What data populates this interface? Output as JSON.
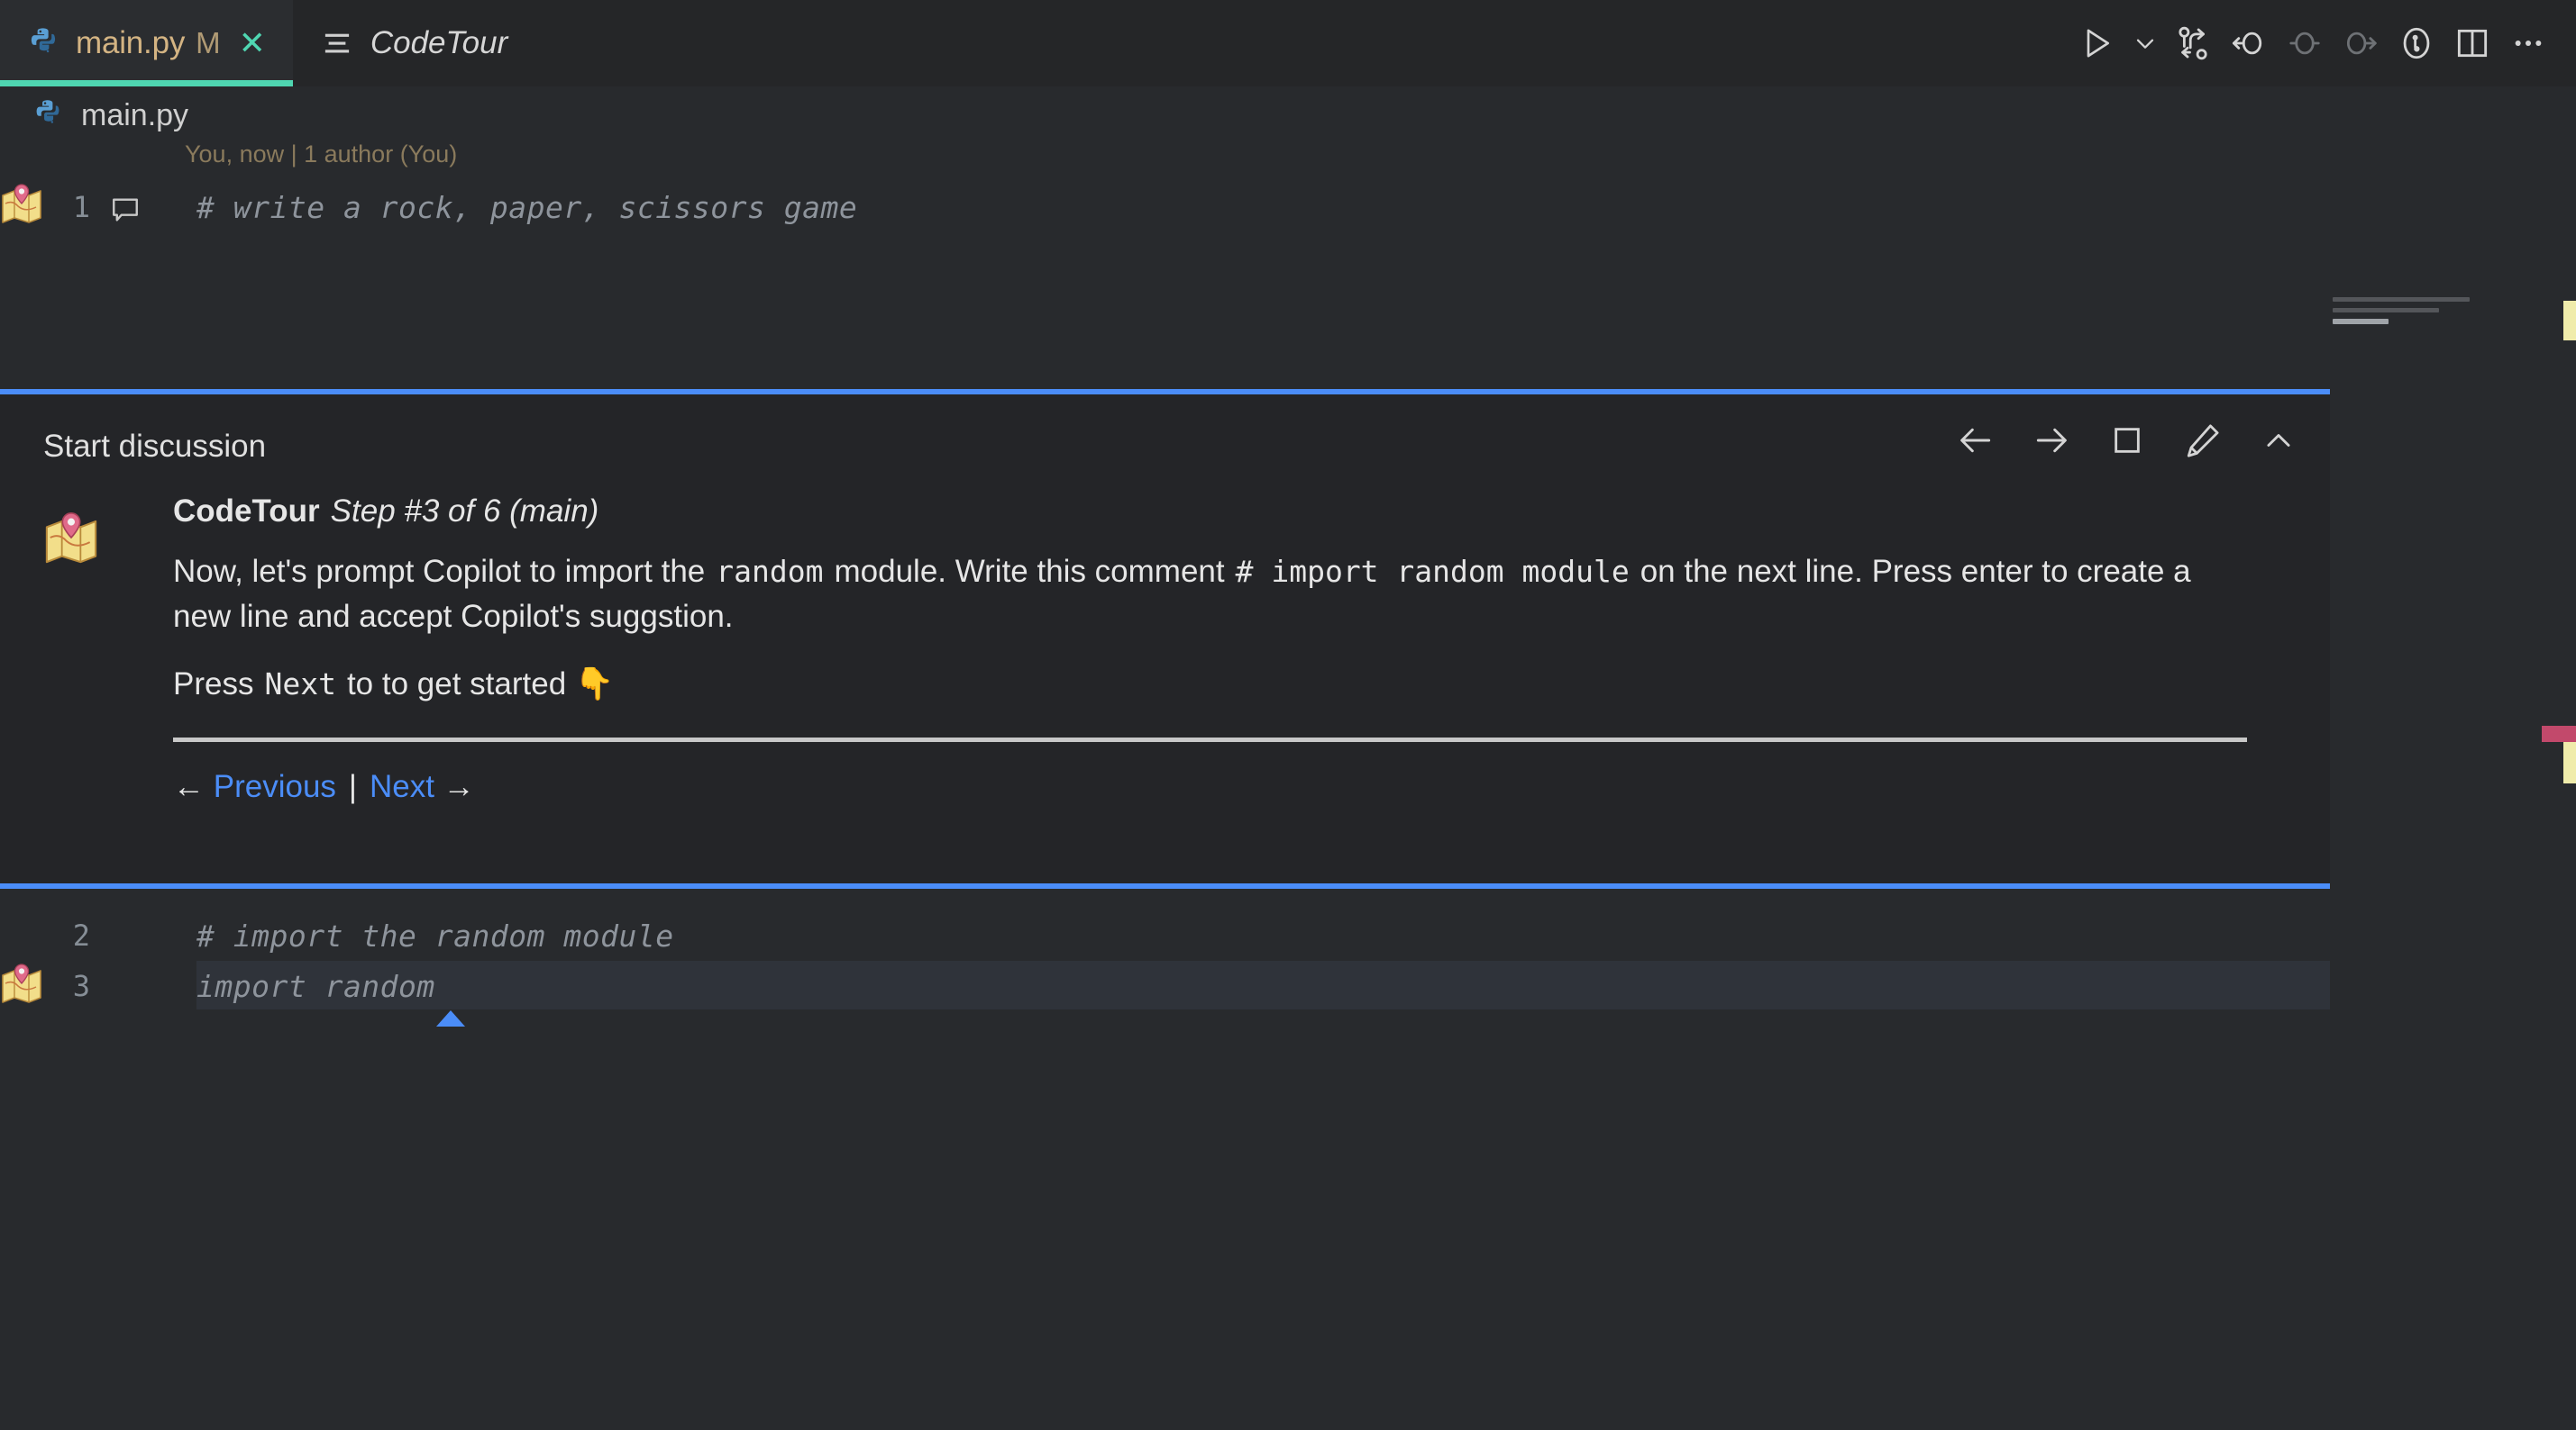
{
  "window": {
    "background": "#282a2d",
    "accent_blue": "#4b8df8",
    "accent_teal": "#4fd6b1"
  },
  "tabs": [
    {
      "label": "main.py",
      "dirty_badge": "M",
      "close_label": "✕",
      "icon": "python-icon",
      "active": true
    },
    {
      "label": "CodeTour",
      "icon": "lines-icon",
      "active": false
    }
  ],
  "toolbar": {
    "buttons": [
      {
        "name": "run-python-file-button",
        "icon": "play-icon",
        "label": "Run Python File"
      },
      {
        "name": "run-options-dropdown",
        "icon": "chevron-down-icon",
        "label": "Run or Debug..."
      },
      {
        "name": "source-control-compare-button",
        "icon": "compare-changes-icon",
        "label": "Open Changes"
      },
      {
        "name": "go-back-button",
        "icon": "arrow-circle-left-icon",
        "label": "Go Back"
      },
      {
        "name": "go-stay-button",
        "icon": "circle-dash-icon",
        "label": "Go Forward"
      },
      {
        "name": "go-forward-button",
        "icon": "arrow-circle-right-icon",
        "label": "Go Forward"
      },
      {
        "name": "run-coverage-button",
        "icon": "beaker-clock-icon",
        "label": "Run Tests with Coverage"
      },
      {
        "name": "split-editor-button",
        "icon": "split-editor-icon",
        "label": "Split Editor Right"
      },
      {
        "name": "more-actions-button",
        "icon": "ellipsis-icon",
        "label": "More Actions..."
      }
    ]
  },
  "breadcrumb": {
    "icon": "python-icon",
    "path": "main.py"
  },
  "editor": {
    "blame": "You, now | 1 author (You)",
    "lines": [
      {
        "number": "1",
        "text": "# write a rock, paper, scissors game",
        "has_comment_icon": true,
        "has_tour_pin": true,
        "current": false
      },
      {
        "number": "2",
        "text": "# import the random module",
        "has_comment_icon": false,
        "has_tour_pin": false,
        "current": false
      },
      {
        "number": "3",
        "text": "import random",
        "has_comment_icon": false,
        "has_tour_pin": true,
        "current": true
      }
    ]
  },
  "codetour_panel": {
    "header": "Start discussion",
    "actions": [
      {
        "name": "previous-step-button",
        "icon": "arrow-left-icon",
        "label": "Previous"
      },
      {
        "name": "next-step-button",
        "icon": "arrow-right-icon",
        "label": "Next"
      },
      {
        "name": "end-tour-button",
        "icon": "stop-square-icon",
        "label": "End Tour"
      },
      {
        "name": "edit-step-button",
        "icon": "pencil-icon",
        "label": "Edit Step"
      },
      {
        "name": "collapse-button",
        "icon": "chevron-up-icon",
        "label": "Collapse"
      }
    ],
    "avatar_icon": "codetour-map-pin-icon",
    "author": "CodeTour",
    "step_meta": "Step #3 of 6 (main)",
    "paragraph1": {
      "part1": "Now, let's prompt Copilot to import the",
      "code1": "random",
      "part2": "module. Write this comment",
      "code2": "# import random module",
      "part3": "on the next line."
    },
    "paragraph1_line2": "Press enter to create a new line and accept Copilot's suggstion.",
    "paragraph2": {
      "part1": "Press",
      "code1": "Next",
      "part2": "to to get started 👇"
    },
    "nav": {
      "prev_arrow": "←",
      "prev_label": "Previous",
      "separator": "|",
      "next_label": "Next",
      "next_arrow": "→"
    }
  },
  "minimap": {
    "lines": [
      "# write a rock, paper, scissors game",
      "# import the random module",
      "import random"
    ]
  },
  "overview_ruler": {
    "marks": [
      {
        "name": "modified-mark",
        "color": "#f0ecab"
      },
      {
        "name": "highlight-mark",
        "color": "#c2496b"
      },
      {
        "name": "modified-mark-2",
        "color": "#f0ecab"
      }
    ]
  }
}
